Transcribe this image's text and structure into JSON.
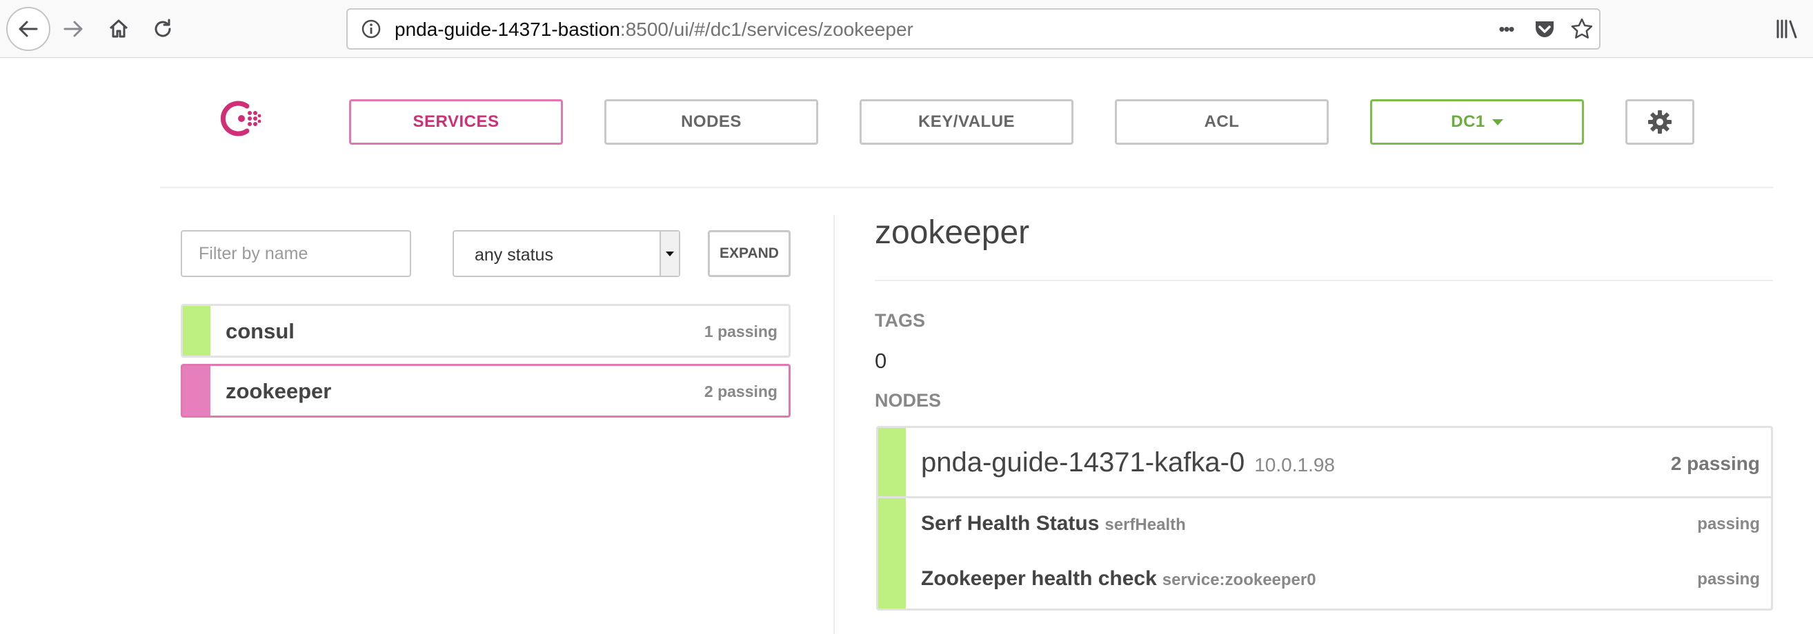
{
  "browser": {
    "url_host": "pnda-guide-14371-bastion",
    "url_rest": ":8500/ui/#/dc1/services/zookeeper",
    "more_glyph": "•••"
  },
  "nav": {
    "services": "SERVICES",
    "nodes": "NODES",
    "key_value": "KEY/VALUE",
    "acl": "ACL",
    "datacenter": "DC1"
  },
  "filter": {
    "placeholder": "Filter by name",
    "status": "any status",
    "expand": "EXPAND"
  },
  "services": [
    {
      "name": "consul",
      "count": "1 passing",
      "status_color": "#bdf07f"
    },
    {
      "name": "zookeeper",
      "count": "2 passing",
      "status_color": "#e87fbd"
    }
  ],
  "detail": {
    "title": "zookeeper",
    "tags_label": "TAGS",
    "tags_value": "0",
    "nodes_label": "NODES",
    "node": {
      "name": "pnda-guide-14371-kafka-0",
      "ip": "10.0.1.98",
      "count": "2 passing",
      "checks": [
        {
          "name": "Serf Health Status",
          "id": "serfHealth",
          "status": "passing"
        },
        {
          "name": "Zookeeper health check",
          "id": "service:zookeeper0",
          "status": "passing"
        }
      ]
    }
  },
  "colors": {
    "accent": "#d12e78",
    "passing": "#bdf07f",
    "dc": "#6bad3a"
  }
}
